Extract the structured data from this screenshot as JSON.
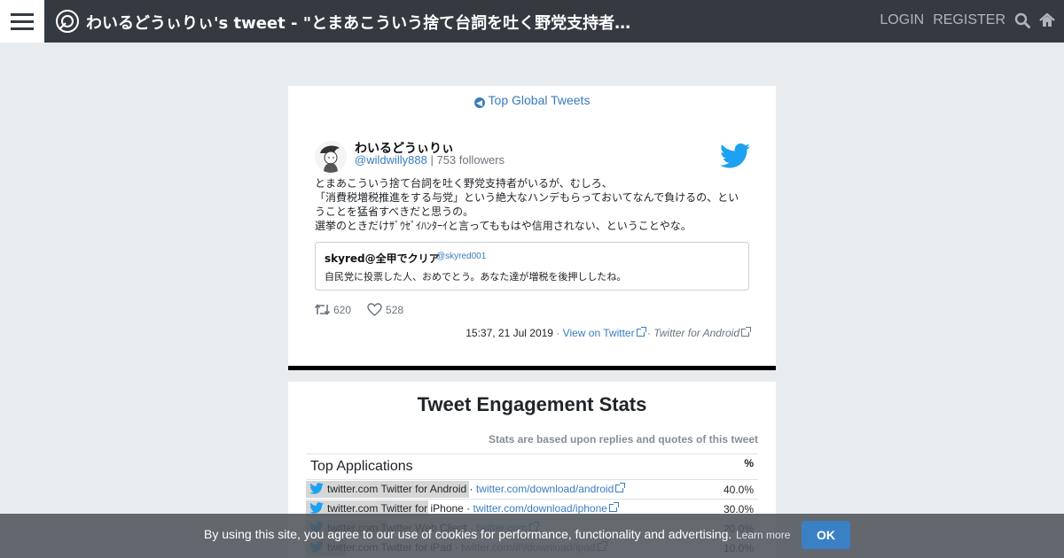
{
  "header": {
    "title": "わいるどうぃりぃ's tweet - \"とまあこういう捨て台詞を吐く野党支持者…",
    "login": "LOGIN",
    "register": "REGISTER",
    "icons": [
      "menu-icon",
      "site-logo",
      "search-icon",
      "home-icon"
    ]
  },
  "tweet": {
    "global_link": "Top Global Tweets",
    "author_name": "わいるどうぃりぃ",
    "handle": "@wildwilly888",
    "followers": "| 753 followers",
    "lines": [
      "とまあこういう捨て台詞を吐く野党支持者がいるが、むしろ、",
      "「消費税増税推進をする与党」という絶大なハンデもらっておいてなんで負けるの、とい",
      "うことを猛省すべきだと思うの。",
      "選挙のときだけｻﾞｳｾﾞｲﾊﾝﾀｰｲと言ってももはや信用されない、ということやな。"
    ],
    "quote": {
      "name": "skyred@全甲でクリア",
      "handle": "@skyred001",
      "text": "自民党に投票した人、おめでとう。あなた達が増税を後押ししたね。"
    },
    "retweets": "620",
    "likes": "528",
    "time": "15:37, 21 Jul 2019",
    "view_link": "View on Twitter",
    "source": "Twitter for Android",
    "separator": "·"
  },
  "stats": {
    "title": "Tweet Engagement Stats",
    "note": "Stats are based upon replies and quotes of this tweet",
    "table_title": "Top Applications",
    "pct_header": "%",
    "apps": [
      {
        "name": "twitter.com Twitter for Android · ",
        "link": "twitter.com/download/android",
        "pct": "40.0%",
        "share": 0.4
      },
      {
        "name": "twitter.com Twitter for iPhone · ",
        "link": "twitter.com/download/iphone",
        "pct": "30.0%",
        "share": 0.3
      },
      {
        "name": "twitter.com Twitter Web Client · ",
        "link": "twitter.com",
        "pct": "20.0%",
        "share": 0.2
      },
      {
        "name": "twitter.com Twitter for iPad · ",
        "link": "twitter.com/#!/download/ipad",
        "pct": "10.0%",
        "share": 0.1
      }
    ]
  },
  "cookie": {
    "text": "By using this site, you agree to our use of cookies for performance, functionality and advertising.",
    "more": "Learn more",
    "ok": "OK"
  },
  "colors": {
    "nav_bg": "#343a40",
    "link": "#3a7bbf",
    "twitter_blue": "#1da1f2",
    "page_bg": "#e9ecef"
  }
}
